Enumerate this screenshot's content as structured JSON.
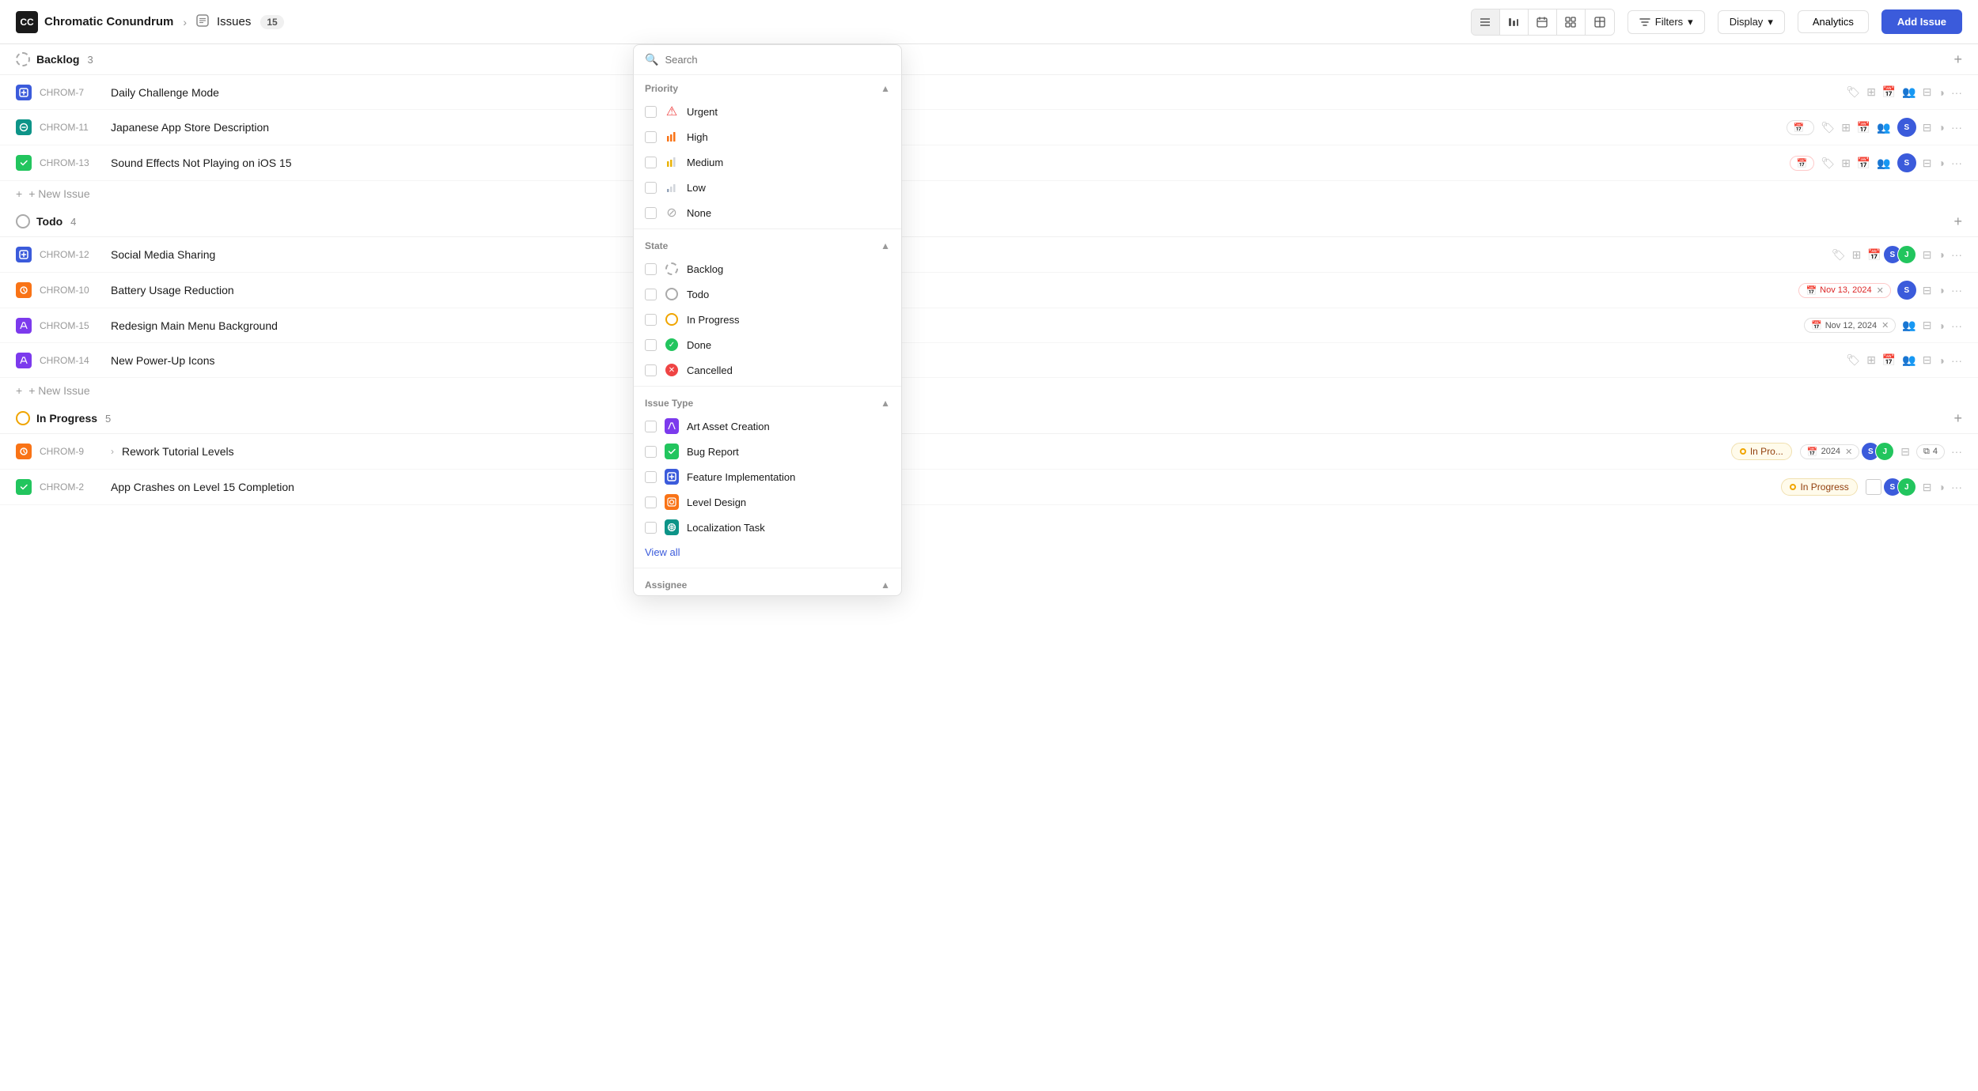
{
  "header": {
    "app_name": "Chromatic Conundrum",
    "breadcrumb_sep": "›",
    "issues_label": "Issues",
    "issues_count": "15",
    "filters_label": "Filters",
    "display_label": "Display",
    "analytics_label": "Analytics",
    "add_issue_label": "Add  Issue"
  },
  "sections": [
    {
      "id": "backlog",
      "title": "Backlog",
      "count": "3",
      "type": "backlog",
      "issues": [
        {
          "id": "CHROM-7",
          "title": "Daily Challenge Mode",
          "icon_type": "blue",
          "actions": true
        },
        {
          "id": "CHROM-11",
          "title": "Japanese App Store Description",
          "icon_type": "orange",
          "actions": true
        },
        {
          "id": "CHROM-13",
          "title": "Sound Effects Not Playing on iOS 15",
          "icon_type": "green",
          "actions": true
        }
      ]
    },
    {
      "id": "todo",
      "title": "Todo",
      "count": "4",
      "type": "todo",
      "issues": [
        {
          "id": "CHROM-12",
          "title": "Social Media Sharing",
          "icon_type": "blue",
          "actions": true
        },
        {
          "id": "CHROM-10",
          "title": "Battery Usage Reduction",
          "icon_type": "orange",
          "actions": true
        },
        {
          "id": "CHROM-15",
          "title": "Redesign Main Menu Background",
          "icon_type": "purple",
          "actions": true
        },
        {
          "id": "CHROM-14",
          "title": "New Power-Up Icons",
          "icon_type": "purple",
          "actions": true
        }
      ]
    },
    {
      "id": "in-progress",
      "title": "In Progress",
      "count": "5",
      "type": "in-progress",
      "issues": [
        {
          "id": "CHROM-9",
          "title": "Rework Tutorial Levels",
          "icon_type": "orange",
          "tag": "In Progress",
          "actions": true
        },
        {
          "id": "CHROM-2",
          "title": "App Crashes on Level 15 Completion",
          "icon_type": "green",
          "tag": "In Progress",
          "actions": true
        }
      ]
    }
  ],
  "new_issue_label": "+ New Issue",
  "filter_dropdown": {
    "search_placeholder": "Search",
    "priority_section": {
      "title": "Priority",
      "items": [
        {
          "label": "Urgent",
          "icon": "urgent"
        },
        {
          "label": "High",
          "icon": "high"
        },
        {
          "label": "Medium",
          "icon": "medium"
        },
        {
          "label": "Low",
          "icon": "low"
        },
        {
          "label": "None",
          "icon": "none"
        }
      ]
    },
    "state_section": {
      "title": "State",
      "items": [
        {
          "label": "Backlog",
          "icon": "backlog"
        },
        {
          "label": "Todo",
          "icon": "todo"
        },
        {
          "label": "In Progress",
          "icon": "inprogress"
        },
        {
          "label": "Done",
          "icon": "done"
        },
        {
          "label": "Cancelled",
          "icon": "cancelled"
        }
      ]
    },
    "issue_type_section": {
      "title": "Issue Type",
      "items": [
        {
          "label": "Art Asset Creation",
          "icon": "art"
        },
        {
          "label": "Bug Report",
          "icon": "bug"
        },
        {
          "label": "Feature Implementation",
          "icon": "feature"
        },
        {
          "label": "Level Design",
          "icon": "level"
        },
        {
          "label": "Localization Task",
          "icon": "local"
        }
      ],
      "view_all": "View all"
    },
    "assignee_section": {
      "title": "Assignee"
    }
  },
  "icons": {
    "search": "🔍",
    "list": "☰",
    "bar": "⟛",
    "calendar": "📅",
    "grid": "⊞",
    "table": "⊟",
    "chevron_down": "▾",
    "chevron_up": "▴",
    "plus": "+",
    "ellipsis": "···",
    "tag": "🏷",
    "clock": "🕐",
    "user": "👤",
    "layers": "⧉",
    "half_circle": "◑"
  }
}
